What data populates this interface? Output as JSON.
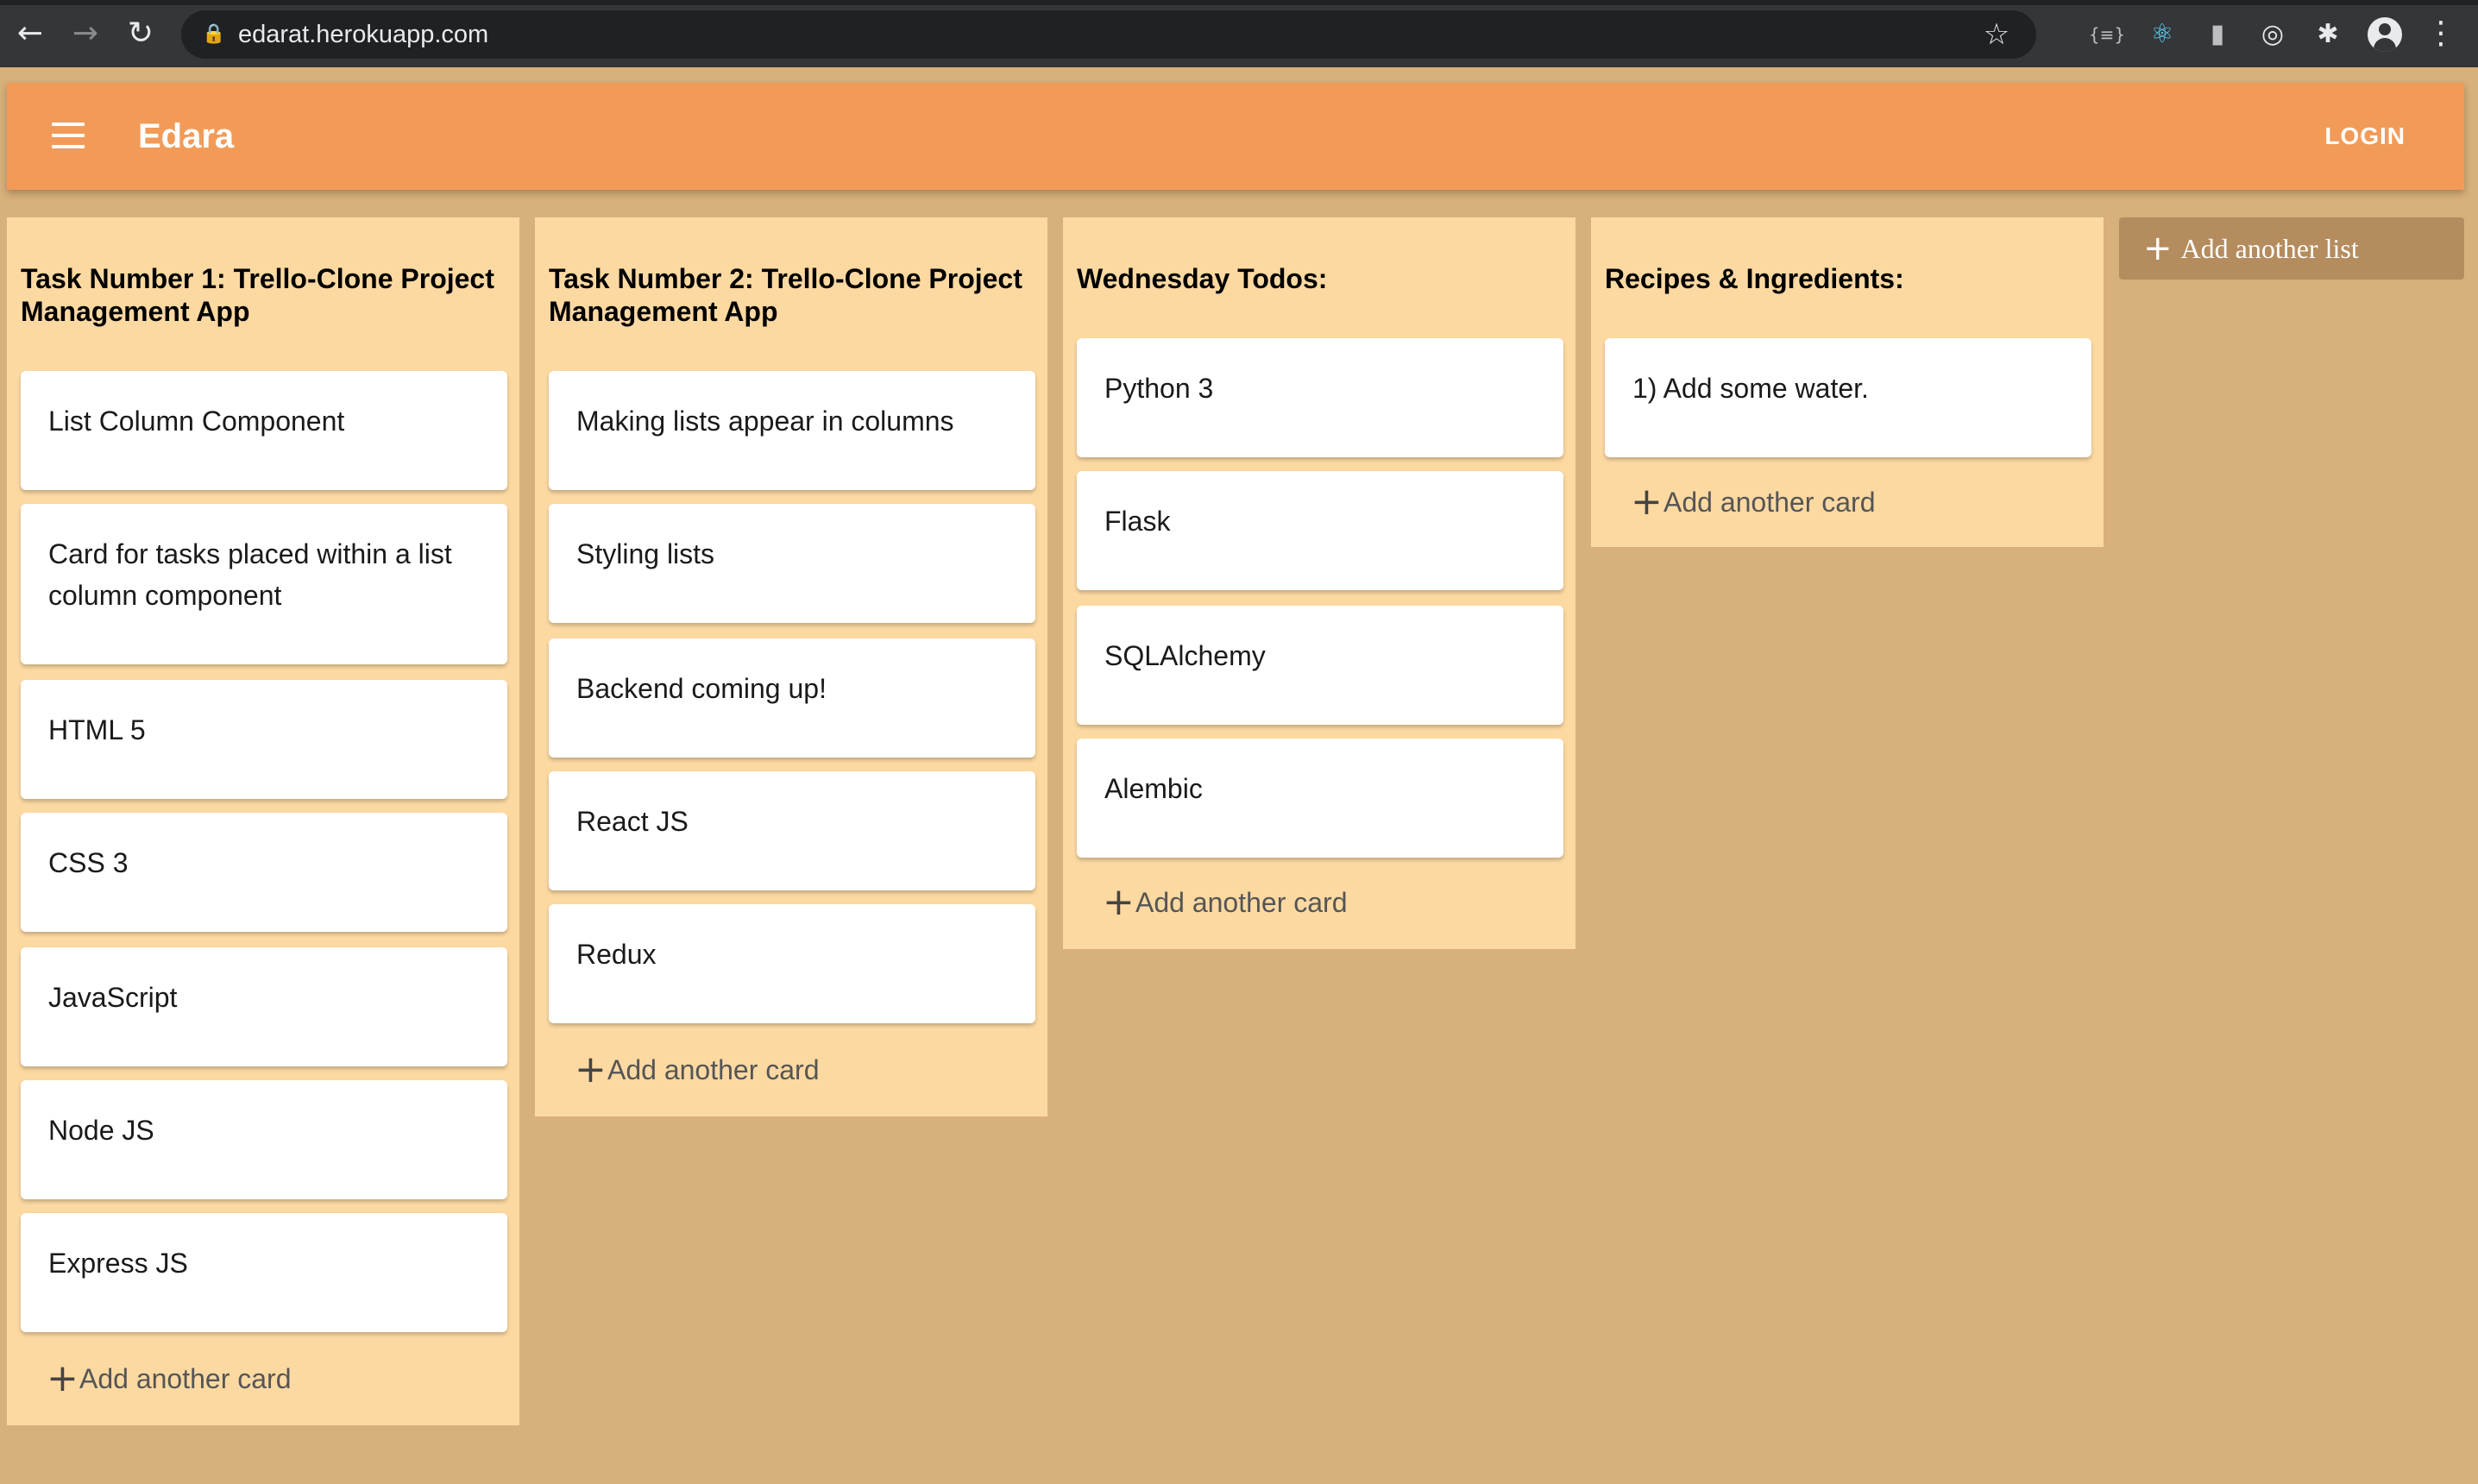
{
  "browser": {
    "url": "edarat.herokuapp.com",
    "back_icon": "←",
    "forward_icon": "→",
    "reload_icon": "↻",
    "lock_icon": "🔒",
    "star_icon": "☆",
    "ext_icons": [
      "{≡}",
      "⚛",
      "▮",
      "◎",
      "✱"
    ],
    "menu_icon": "⋮"
  },
  "app": {
    "title": "Edara",
    "login_label": "LOGIN",
    "accent_color": "#f29b58",
    "board_color": "#d8b07b",
    "list_color": "#fdd9a2"
  },
  "lists": [
    {
      "title": "Task Number 1: Trello-Clone Project Management App",
      "cards": [
        "List Column Component",
        "Card for tasks placed within a list column component",
        "HTML 5",
        "CSS 3",
        "JavaScript",
        "Node JS",
        "Express JS"
      ],
      "add_card_label": "Add another card"
    },
    {
      "title": "Task Number 2: Trello-Clone Project Management App",
      "cards": [
        "Making lists appear in columns",
        "Styling lists",
        "Backend coming up!",
        "React JS",
        "Redux"
      ],
      "add_card_label": "Add another card"
    },
    {
      "title": "Wednesday Todos:",
      "cards": [
        "Python 3",
        "Flask",
        "SQLAlchemy",
        "Alembic"
      ],
      "add_card_label": "Add another card"
    },
    {
      "title": "Recipes & Ingredients:",
      "cards": [
        "1) Add some water."
      ],
      "add_card_label": "Add another card"
    }
  ],
  "add_list_label": "Add another list",
  "plus_icon": "+"
}
